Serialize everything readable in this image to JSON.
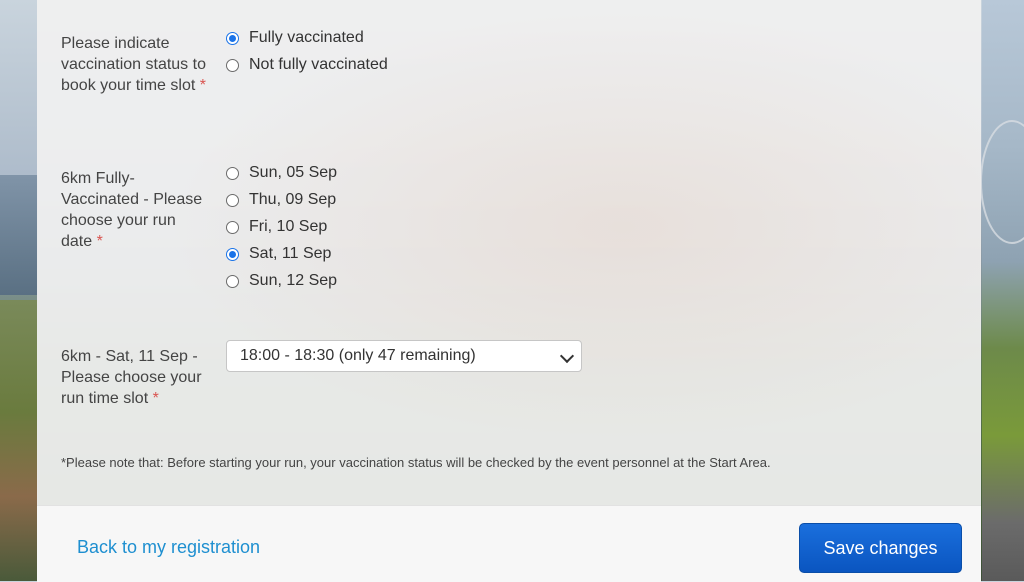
{
  "vaccination": {
    "label": "Please indicate vaccination status to book your time slot",
    "required_mark": "*",
    "options": [
      {
        "label": "Fully vaccinated",
        "checked": true
      },
      {
        "label": "Not fully vaccinated",
        "checked": false
      }
    ]
  },
  "run_date": {
    "label": "6km Fully-Vaccinated - Please choose your run date",
    "required_mark": "*",
    "options": [
      {
        "label": "Sun, 05 Sep",
        "checked": false
      },
      {
        "label": "Thu, 09 Sep",
        "checked": false
      },
      {
        "label": "Fri, 10 Sep",
        "checked": false
      },
      {
        "label": "Sat, 11 Sep",
        "checked": true
      },
      {
        "label": "Sun, 12 Sep",
        "checked": false
      }
    ]
  },
  "time_slot": {
    "label": "6km - Sat, 11 Sep - Please choose your run time slot",
    "required_mark": "*",
    "selected": "18:00 - 18:30 (only 47 remaining)"
  },
  "note": "*Please note that: Before starting your run, your vaccination status will be checked by the event personnel at the Start Area.",
  "footer": {
    "back_link": "Back to my registration",
    "save_button": "Save changes"
  },
  "colors": {
    "accent": "#1a73e8",
    "link": "#1e8fd0",
    "button": "#0a55c0",
    "required": "#d9534f"
  }
}
